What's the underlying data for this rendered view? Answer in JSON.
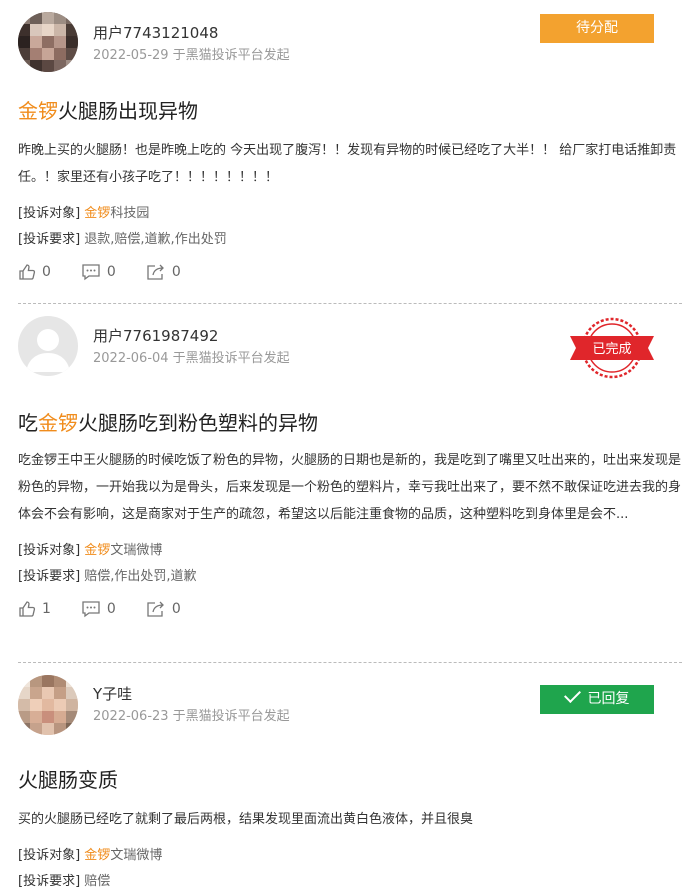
{
  "posts": [
    {
      "username": "用户7743121048",
      "date": "2022-05-29",
      "source": "于黑猫投诉平台发起",
      "status": "待分配",
      "title_prefix": "",
      "title_brand": "金锣",
      "title_rest": "火腿肠出现异物",
      "description": "昨晚上买的火腿肠！也是昨晚上吃的 今天出现了腹泻！！发现有异物的时候已经吃了大半！！ 给厂家打电话推卸责任。！家里还有小孩子吃了！！！！！！！！",
      "target_label": "[投诉对象]",
      "target_brand": "金锣",
      "target_rest": "科技园",
      "request_label": "[投诉要求]",
      "request_value": "退款,赔偿,道歉,作出处罚",
      "likes": "0",
      "comments": "0",
      "shares": "0"
    },
    {
      "username": "用户7761987492",
      "date": "2022-06-04",
      "source": "于黑猫投诉平台发起",
      "status": "已完成",
      "title_prefix": "吃",
      "title_brand": "金锣",
      "title_rest": "火腿肠吃到粉色塑料的异物",
      "description": "吃金锣王中王火腿肠的时候吃饭了粉色的异物，火腿肠的日期也是新的，我是吃到了嘴里又吐出来的，吐出来发现是粉色的异物，一开始我以为是骨头，后来发现是一个粉色的塑料片，幸亏我吐出来了，要不然不敢保证吃进去我的身体会不会有影响，这是商家对于生产的疏忽，希望这以后能注重食物的品质，这种塑料吃到身体里是会不...",
      "target_label": "[投诉对象]",
      "target_brand": "金锣",
      "target_rest": "文瑞微博",
      "request_label": "[投诉要求]",
      "request_value": "赔偿,作出处罚,道歉",
      "likes": "1",
      "comments": "0",
      "shares": "0"
    },
    {
      "username": "Y子哇",
      "date": "2022-06-23",
      "source": "于黑猫投诉平台发起",
      "status": "已回复",
      "title_prefix": "",
      "title_brand": "",
      "title_rest": "火腿肠变质",
      "description": "买的火腿肠已经吃了就剩了最后两根，结果发现里面流出黄白色液体，并且很臭",
      "target_label": "[投诉对象]",
      "target_brand": "金锣",
      "target_rest": "文瑞微博",
      "request_label": "[投诉要求]",
      "request_value": "赔偿"
    }
  ],
  "icons": {
    "like": "thumbs-up-icon",
    "comment": "comment-icon",
    "share": "share-icon"
  },
  "colors": {
    "brand_highlight": "#f08c1c",
    "pending": "#f3a22f",
    "replied": "#1fa54d",
    "completed_stamp": "#e0262b"
  }
}
